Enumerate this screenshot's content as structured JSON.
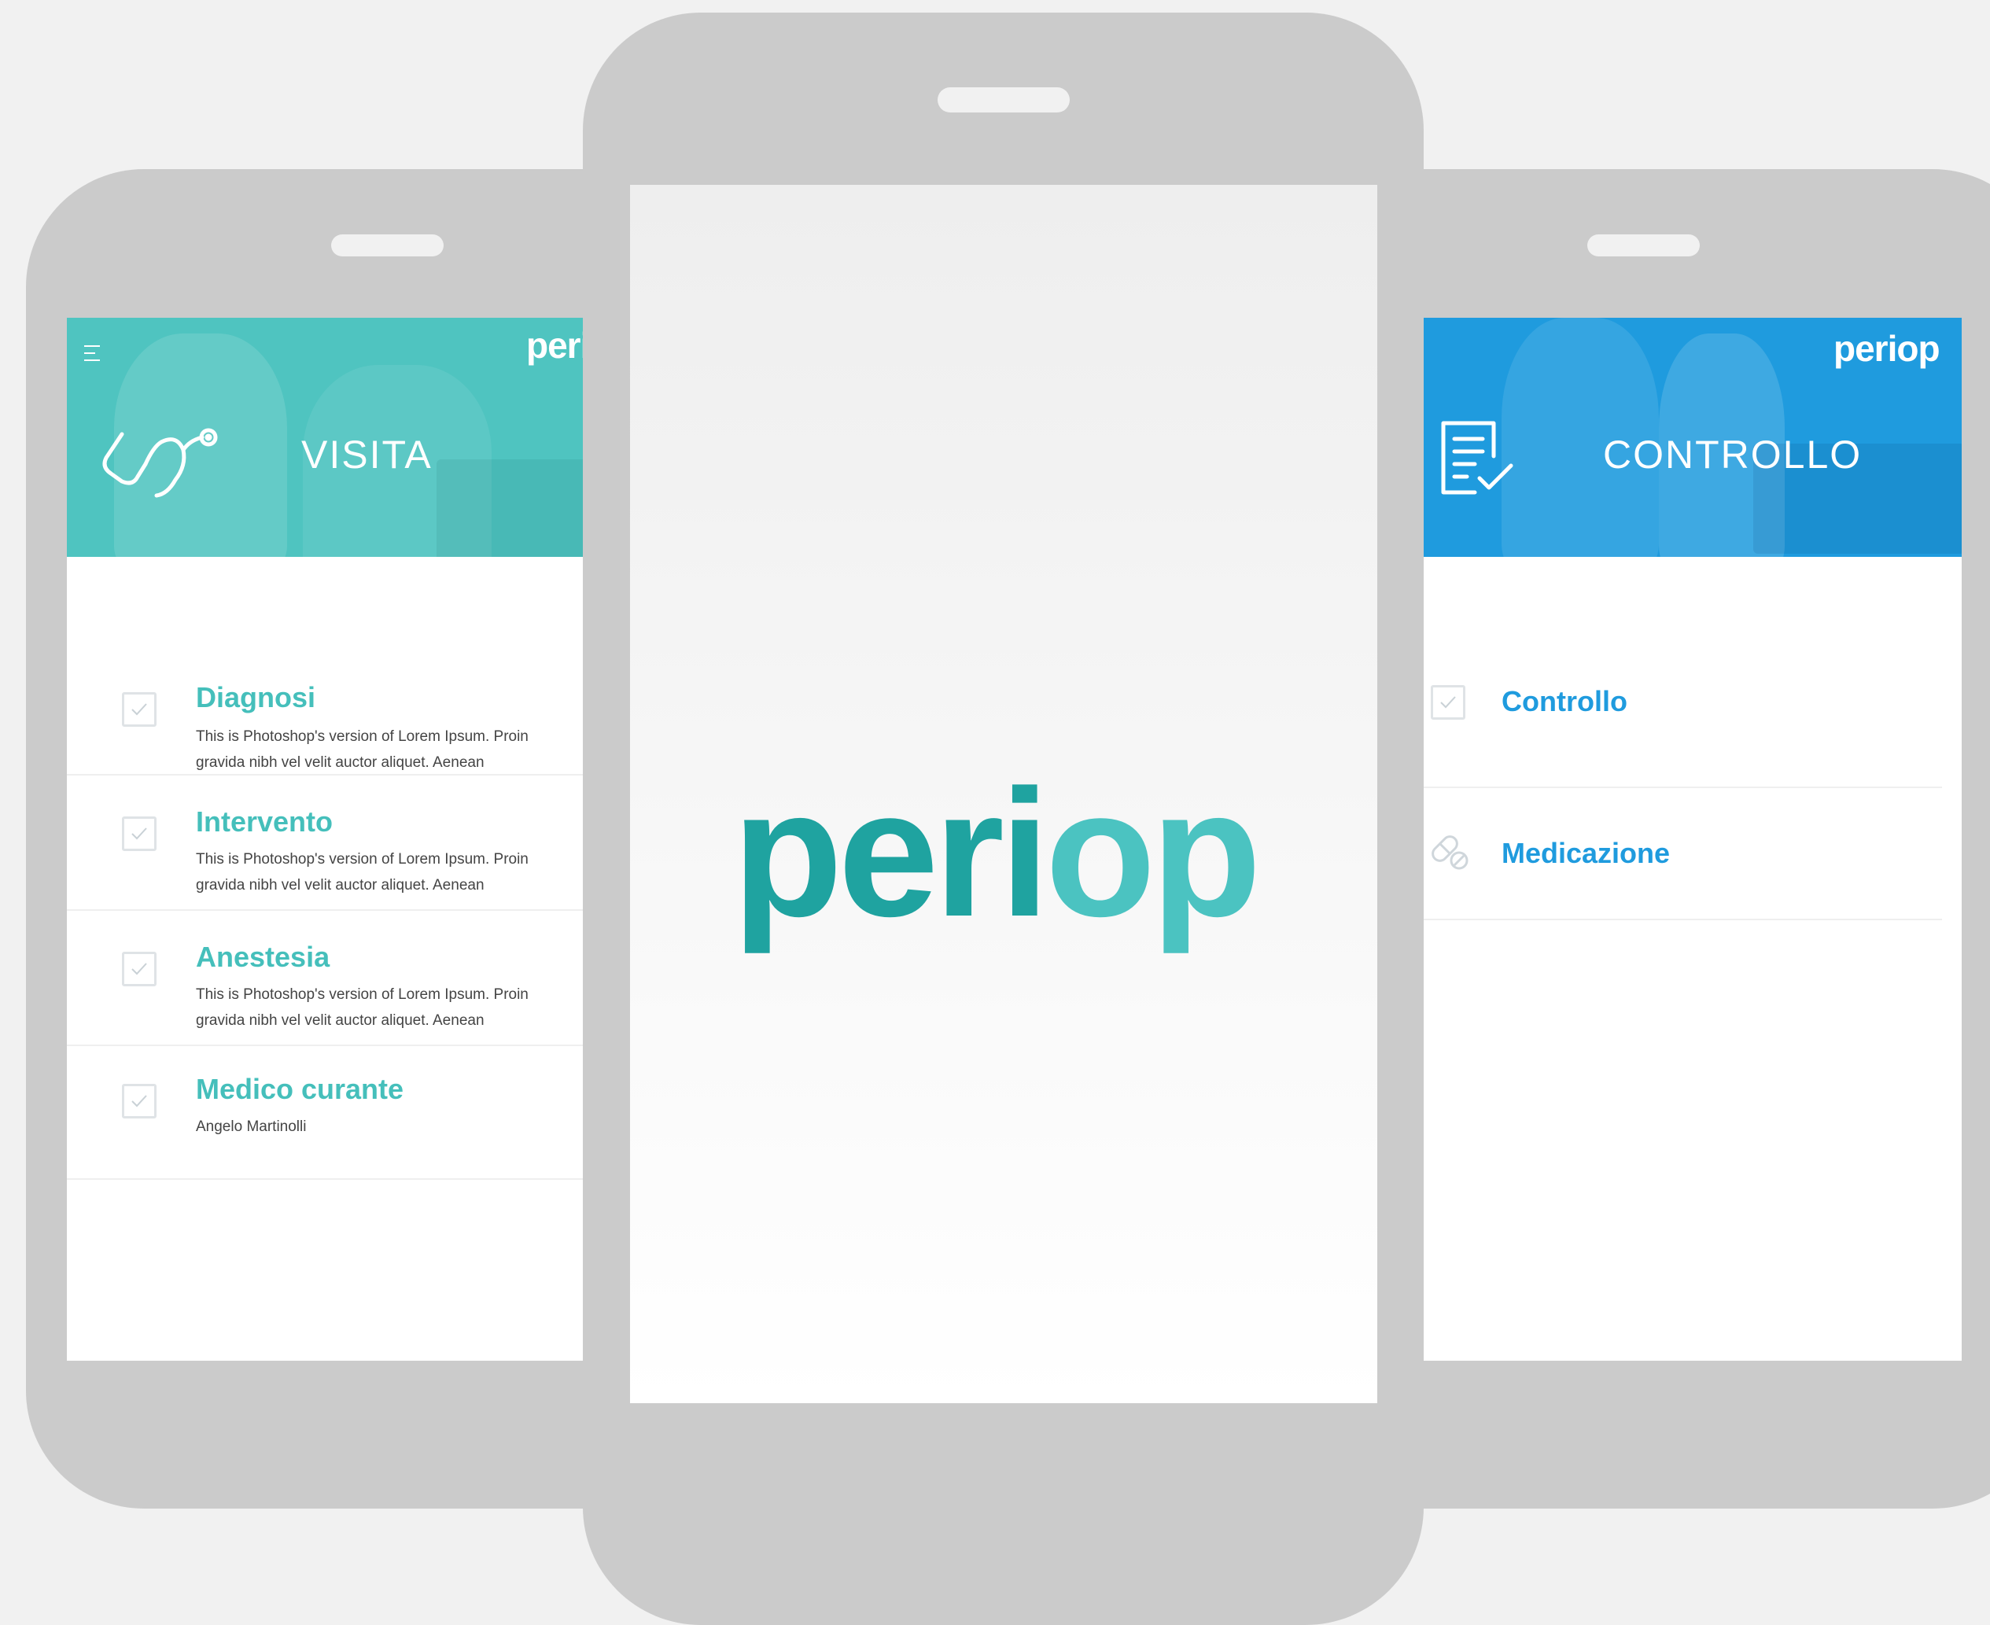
{
  "colors": {
    "background": "#f1f1f1",
    "device": "#cbcbcb",
    "teal": "#45bfbb",
    "teal_dark": "#1fa3a0",
    "blue": "#1f9bde"
  },
  "left_screen": {
    "brand": "peri",
    "menu_icon": "hamburger-icon",
    "header_icon": "stethoscope-icon",
    "title": "VISITA",
    "items": [
      {
        "title": "Diagnosi",
        "desc_line1": "This is Photoshop's version  of Lorem Ipsum. Proin",
        "desc_line2": "gravida nibh vel velit auctor aliquet. Aenean"
      },
      {
        "title": "Intervento",
        "desc_line1": "This is Photoshop's version  of Lorem Ipsum. Proin",
        "desc_line2": "gravida nibh vel velit auctor aliquet. Aenean"
      },
      {
        "title": "Anestesia",
        "desc_line1": "This is Photoshop's version  of Lorem Ipsum. Proin",
        "desc_line2": "gravida nibh vel velit auctor aliquet. Aenean"
      },
      {
        "title": "Medico curante",
        "desc_line1": "Angelo Martinolli"
      }
    ]
  },
  "center_screen": {
    "logo_part1": "peri",
    "logo_part2": "op"
  },
  "right_screen": {
    "brand": "periop",
    "header_icon": "checklist-icon",
    "title": "CONTROLLO",
    "items": [
      {
        "title": "Controllo",
        "icon": "checkbox-icon"
      },
      {
        "title": "Medicazione",
        "icon": "pill-icon"
      }
    ]
  }
}
